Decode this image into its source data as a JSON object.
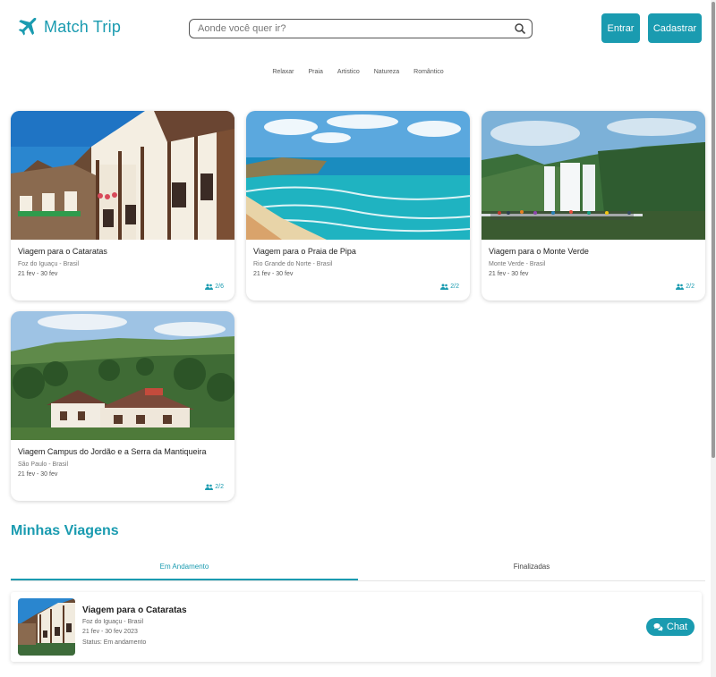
{
  "header": {
    "app_name": "Match Trip",
    "search_placeholder": "Aonde você quer ir?",
    "login_label": "Entrar",
    "signup_label": "Cadastrar"
  },
  "categories": [
    "Relaxar",
    "Praia",
    "Artistico",
    "Natureza",
    "Romântico"
  ],
  "trips": [
    {
      "title": "Viagem para o Cataratas",
      "location": "Foz do Iguaçu - Brasil",
      "dates": "21 fev - 30 fev",
      "people": "2/6"
    },
    {
      "title": "Viagem para o Praia de Pipa",
      "location": "Rio Grande do Norte - Brasil",
      "dates": "21 fev - 30 fev",
      "people": "2/2"
    },
    {
      "title": "Viagem para o Monte Verde",
      "location": "Monte Verde - Brasil",
      "dates": "21 fev - 30 fev",
      "people": "2/2"
    },
    {
      "title": "Viagem Campus do Jordão e a Serra da Mantiqueira",
      "location": "São Paulo - Brasil",
      "dates": "21 fev - 30 fev",
      "people": "2/2"
    }
  ],
  "my_trips": {
    "section_title": "Minhas Viagens",
    "tabs": [
      {
        "label": "Em Andamento"
      },
      {
        "label": "Finalizadas"
      }
    ],
    "items": [
      {
        "title": "Viagem para o Cataratas",
        "location": "Foz do Iguaçu - Brasil",
        "dates": "21 fev - 30 fev 2023",
        "status": "Status: Em andamento",
        "chat_label": "Chat"
      }
    ]
  },
  "colors": {
    "accent": "#1a9bb0"
  },
  "icons": [
    "plane-icon",
    "search-icon",
    "people-icon",
    "chat-icon"
  ]
}
